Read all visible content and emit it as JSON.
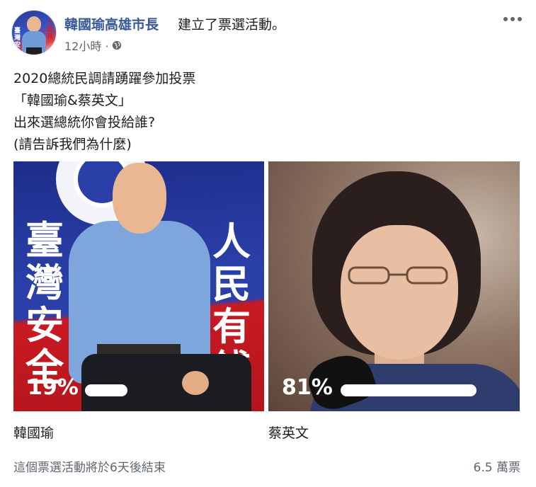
{
  "header": {
    "page_name": "韓國瑜高雄市長",
    "action": "建立了票選活動。",
    "time": "12小時 ·",
    "icons": [
      "globe-icon",
      "more-dots-icon"
    ]
  },
  "avatar": {
    "sign_left": "臺灣安",
    "sign_right": "人民有"
  },
  "post_text": {
    "line1": "2020總統民調請踴躍參加投票",
    "line2": "「韓國瑜&蔡英文」",
    "line3": "出來選總統你會投給誰?",
    "line4": "(請告訴我們為什麼)"
  },
  "poll": {
    "options": [
      {
        "name": "韓國瑜",
        "percent_label": "19%",
        "percent": 19,
        "banner_left": "臺灣安全",
        "banner_right": "人民有錢"
      },
      {
        "name": "蔡英文",
        "percent_label": "81%",
        "percent": 81
      }
    ]
  },
  "footer": {
    "ends": "這個票選活動將於6天後結束",
    "votes": "6.5 萬票"
  },
  "colors": {
    "link_blue": "#385898",
    "meta_gray": "#606770",
    "flag_blue": "#2a3fa8",
    "flag_red": "#c91a22"
  }
}
